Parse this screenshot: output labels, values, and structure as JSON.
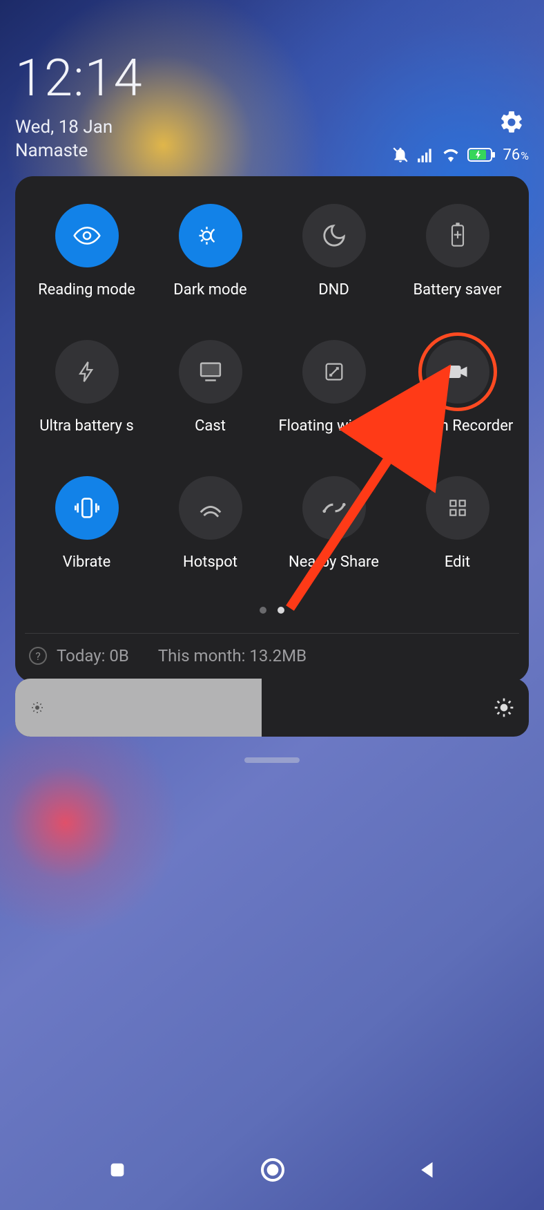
{
  "status": {
    "time": "12:14",
    "date": "Wed, 18 Jan",
    "greeting": "Namaste",
    "battery_pct": "76",
    "pct_sym": "%"
  },
  "tiles": {
    "reading_mode": "Reading mode",
    "dark_mode": "Dark mode",
    "dnd": "DND",
    "battery_saver": "Battery saver",
    "ultra_battery": "Ultra battery s",
    "cast": "Cast",
    "floating_windows": "Floating window",
    "screen_recorder": "Screen Recorder",
    "vibrate": "Vibrate",
    "hotspot": "Hotspot",
    "nearby_share": "Nearby Share",
    "edit": "Edit"
  },
  "usage": {
    "today": "Today: 0B",
    "month": "This month: 13.2MB"
  }
}
